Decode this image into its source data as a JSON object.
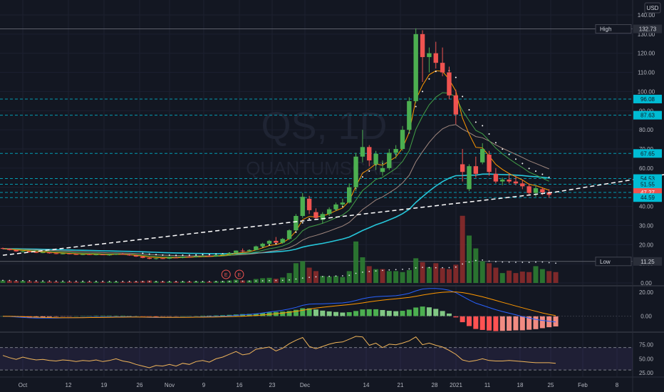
{
  "watermark": {
    "ticker": "QS, 1D",
    "name": "QUANTUMSCAPE"
  },
  "currency": "USD",
  "colors": {
    "up": "#26a69a",
    "down": "#ef5350",
    "ma_fast": "#ff9800",
    "ma_mid": "#43a047",
    "ma_slow": "#a1887f",
    "ma_long": "#26c6da",
    "levels": "#00bcd4",
    "trend": "#ffffff",
    "macd": "#2962ff",
    "signal": "#ff9800",
    "rsi": "#f0b55a",
    "rsi_band": "#7e57c2"
  },
  "main_axis": {
    "ticks": [
      "140.00",
      "130.00",
      "120.00",
      "110.00",
      "100.00",
      "90.00",
      "80.00",
      "70.00",
      "60.00",
      "50.00",
      "40.00",
      "30.00",
      "20.00",
      "10.00",
      "0.00"
    ]
  },
  "flags": {
    "high": {
      "label": "High",
      "value": "132.73"
    },
    "low": {
      "label": "Low",
      "value": "11.25"
    },
    "levels": [
      "96.08",
      "87.63",
      "67.65",
      "54.53",
      "51.55",
      "47.27",
      "44.59"
    ]
  },
  "earnings_markers": [
    "E",
    "E"
  ],
  "macd_axis": {
    "ticks": [
      "20.00",
      "0.00"
    ]
  },
  "rsi_axis": {
    "ticks": [
      "75.00",
      "50.00",
      "25.00"
    ]
  },
  "time_axis": {
    "labels": [
      "Oct",
      "12",
      "19",
      "26",
      "Nov",
      "9",
      "16",
      "23",
      "Dec",
      "14",
      "21",
      "28",
      "2021",
      "11",
      "18",
      "25",
      "Feb",
      "8"
    ]
  },
  "chart_data": {
    "type": "candlestick",
    "ylim": [
      0,
      140
    ],
    "candles": [
      [
        18.2,
        18.5,
        17.6,
        17.9
      ],
      [
        17.9,
        18.1,
        17,
        17.2
      ],
      [
        17.2,
        17.4,
        16.3,
        16.5
      ],
      [
        16.5,
        16.9,
        15.9,
        16.6
      ],
      [
        16.6,
        16.8,
        15.9,
        16.1
      ],
      [
        16.1,
        16.4,
        15.6,
        15.8
      ],
      [
        15.8,
        16.2,
        15.5,
        16
      ],
      [
        16,
        16.2,
        15.3,
        15.5
      ],
      [
        15.5,
        15.8,
        15,
        15.3
      ],
      [
        15.3,
        15.6,
        14.9,
        15.4
      ],
      [
        15.4,
        15.7,
        15,
        15.1
      ],
      [
        15.1,
        15.4,
        14.6,
        14.8
      ],
      [
        14.8,
        15.2,
        14.5,
        15
      ],
      [
        15,
        15.3,
        14.6,
        14.7
      ],
      [
        14.7,
        15.1,
        14.4,
        14.9
      ],
      [
        14.9,
        15.2,
        14.5,
        14.6
      ],
      [
        14.6,
        14.9,
        14.2,
        14.8
      ],
      [
        14.8,
        15.3,
        14.6,
        15.2
      ],
      [
        15.2,
        15.5,
        14.8,
        14.9
      ],
      [
        14.9,
        15.2,
        14.2,
        14.4
      ],
      [
        14.4,
        14.7,
        13.6,
        13.8
      ],
      [
        13.8,
        14.1,
        12.9,
        13.1
      ],
      [
        13.1,
        13.4,
        12.4,
        12.6
      ],
      [
        12.6,
        13.1,
        12.2,
        12.9
      ],
      [
        12.9,
        13.3,
        12.5,
        12.7
      ],
      [
        12.7,
        13.5,
        12.5,
        13.3
      ],
      [
        13.3,
        13.8,
        13,
        13.1
      ],
      [
        13.1,
        13.9,
        12.9,
        13.7
      ],
      [
        13.7,
        14.2,
        13.4,
        13.5
      ],
      [
        13.5,
        14.2,
        13.3,
        14
      ],
      [
        14,
        14.5,
        13.7,
        14.2
      ],
      [
        14.2,
        14.6,
        13.8,
        13.9
      ],
      [
        13.9,
        14.8,
        13.7,
        14.6
      ],
      [
        14.6,
        15.2,
        14.3,
        14.9
      ],
      [
        14.9,
        16,
        14.6,
        15.7
      ],
      [
        15.7,
        17,
        15.5,
        16.9
      ],
      [
        16.9,
        18,
        16.4,
        16.6
      ],
      [
        16.6,
        17.5,
        16.2,
        17.2
      ],
      [
        17.2,
        19.5,
        17,
        19.1
      ],
      [
        19.1,
        21,
        18.5,
        20.5
      ],
      [
        20.5,
        22.5,
        20,
        22
      ],
      [
        22,
        24,
        21.5,
        21
      ],
      [
        21,
        23.5,
        20.5,
        23
      ],
      [
        23,
        28,
        22.5,
        27.5
      ],
      [
        27.5,
        36,
        27,
        35
      ],
      [
        35,
        47,
        34,
        45
      ],
      [
        44,
        45.5,
        36,
        38
      ],
      [
        37,
        39,
        33,
        34
      ],
      [
        33,
        37,
        31,
        36
      ],
      [
        36,
        39.5,
        35,
        38.5
      ],
      [
        38.5,
        42,
        37.5,
        41
      ],
      [
        41,
        44,
        40,
        42
      ],
      [
        42,
        52,
        41.5,
        50
      ],
      [
        50,
        68,
        48,
        66
      ],
      [
        66,
        80,
        63,
        71
      ],
      [
        71,
        72,
        61,
        64
      ],
      [
        62,
        69,
        59,
        67.5
      ],
      [
        58,
        64,
        56,
        60
      ],
      [
        60,
        70,
        59,
        68
      ],
      [
        68,
        72,
        65,
        70
      ],
      [
        70,
        82,
        69,
        80
      ],
      [
        80,
        97,
        78,
        95
      ],
      [
        95,
        133,
        94,
        130
      ],
      [
        130,
        132,
        105,
        118
      ],
      [
        118,
        123,
        110,
        120
      ],
      [
        120,
        126,
        112,
        115
      ],
      [
        115,
        123,
        108,
        110
      ],
      [
        110,
        113,
        96,
        98
      ],
      [
        98,
        101,
        83,
        88
      ],
      [
        62,
        70,
        53,
        58
      ],
      [
        49,
        62,
        48,
        61
      ],
      [
        61,
        66,
        55,
        57
      ],
      [
        63,
        73,
        62,
        70
      ],
      [
        67,
        69,
        56,
        58
      ],
      [
        57,
        60,
        52,
        53
      ],
      [
        53,
        55,
        51,
        54
      ],
      [
        54,
        57,
        52,
        53
      ],
      [
        53,
        56,
        51,
        52
      ],
      [
        52,
        54,
        49,
        50.5
      ],
      [
        50.5,
        52,
        46,
        47
      ],
      [
        47,
        51,
        45,
        49.5
      ],
      [
        49,
        50,
        46,
        47.3
      ],
      [
        47.3,
        49,
        44.5,
        46
      ]
    ],
    "volume": [
      [
        2.6,
        1
      ],
      [
        2.4,
        0
      ],
      [
        2.1,
        0
      ],
      [
        2.2,
        1
      ],
      [
        1.8,
        0
      ],
      [
        1.6,
        0
      ],
      [
        1.5,
        1
      ],
      [
        1.6,
        0
      ],
      [
        1.4,
        0
      ],
      [
        1.4,
        1
      ],
      [
        1.4,
        0
      ],
      [
        1.3,
        0
      ],
      [
        1.4,
        1
      ],
      [
        1.3,
        0
      ],
      [
        1.3,
        1
      ],
      [
        1.2,
        0
      ],
      [
        1.3,
        1
      ],
      [
        1.4,
        1
      ],
      [
        1.2,
        0
      ],
      [
        1.3,
        0
      ],
      [
        1.6,
        0
      ],
      [
        2,
        0
      ],
      [
        2.5,
        0
      ],
      [
        1.7,
        1
      ],
      [
        1.6,
        0
      ],
      [
        1.5,
        1
      ],
      [
        1.5,
        0
      ],
      [
        1.6,
        1
      ],
      [
        1.5,
        0
      ],
      [
        1.7,
        1
      ],
      [
        1.5,
        1
      ],
      [
        1.4,
        0
      ],
      [
        1.8,
        1
      ],
      [
        1.9,
        1
      ],
      [
        2.5,
        1
      ],
      [
        3.3,
        1
      ],
      [
        2.5,
        0
      ],
      [
        2.5,
        1
      ],
      [
        4,
        1
      ],
      [
        4.8,
        1
      ],
      [
        5.2,
        1
      ],
      [
        4.3,
        0
      ],
      [
        5.5,
        1
      ],
      [
        10,
        1
      ],
      [
        20,
        1
      ],
      [
        22,
        1
      ],
      [
        15.5,
        0
      ],
      [
        12,
        0
      ],
      [
        7,
        1
      ],
      [
        6.5,
        1
      ],
      [
        7,
        1
      ],
      [
        6,
        1
      ],
      [
        12,
        1
      ],
      [
        42,
        1
      ],
      [
        26,
        1
      ],
      [
        17,
        0
      ],
      [
        14,
        1
      ],
      [
        14,
        0
      ],
      [
        12,
        1
      ],
      [
        12,
        1
      ],
      [
        11,
        1
      ],
      [
        13,
        1
      ],
      [
        25,
        1
      ],
      [
        21,
        0
      ],
      [
        16,
        1
      ],
      [
        20,
        0
      ],
      [
        15,
        0
      ],
      [
        14,
        0
      ],
      [
        18.5,
        0
      ],
      [
        68,
        0
      ],
      [
        48,
        1
      ],
      [
        35,
        1
      ],
      [
        22,
        1
      ],
      [
        20,
        0
      ],
      [
        15.5,
        0
      ],
      [
        10,
        1
      ],
      [
        12.5,
        0
      ],
      [
        10,
        0
      ],
      [
        11.5,
        0
      ],
      [
        11,
        0
      ],
      [
        17,
        1
      ],
      [
        14,
        1
      ],
      [
        12,
        0
      ],
      [
        11,
        0
      ]
    ],
    "volume_max": 70,
    "trendline": [
      [
        0,
        14.5
      ],
      [
        83,
        47.5
      ],
      [
        100,
        57
      ]
    ],
    "macd": {
      "ylim": [
        -12,
        24
      ],
      "macd": [
        0,
        -0.2,
        -0.6,
        -1,
        -1.3,
        -1.5,
        -1.5,
        -1.5,
        -1.5,
        -1.4,
        -1.3,
        -1.2,
        -1,
        -0.9,
        -0.8,
        -0.7,
        -0.6,
        -0.5,
        -0.5,
        -0.5,
        -0.6,
        -0.8,
        -1,
        -1.1,
        -1.1,
        -1.1,
        -1,
        -0.9,
        -0.8,
        -0.6,
        -0.5,
        -0.4,
        -0.2,
        0,
        0.3,
        0.7,
        1.1,
        1.5,
        2,
        2.7,
        3.5,
        4.2,
        5,
        6,
        7.3,
        9,
        10,
        10.2,
        10.3,
        10.5,
        10.8,
        11,
        11.7,
        13,
        14.5,
        15.5,
        16.2,
        16.5,
        16.7,
        17,
        17.8,
        19,
        21,
        22.5,
        23,
        23,
        22.5,
        21.5,
        19.5,
        16.5,
        13.5,
        10.8,
        9,
        7.2,
        5.4,
        3.9,
        2.5,
        1.2,
        -0.3,
        -1.5,
        -2.6,
        -3.5,
        -4.2,
        -4.8
      ],
      "signal": [
        0,
        -0.1,
        -0.2,
        -0.4,
        -0.6,
        -0.8,
        -1,
        -1.1,
        -1.2,
        -1.2,
        -1.2,
        -1.2,
        -1.2,
        -1.1,
        -1.1,
        -1,
        -0.9,
        -0.8,
        -0.8,
        -0.7,
        -0.7,
        -0.7,
        -0.8,
        -0.8,
        -0.9,
        -0.9,
        -0.9,
        -0.9,
        -0.9,
        -0.8,
        -0.8,
        -0.7,
        -0.6,
        -0.5,
        -0.4,
        -0.2,
        0,
        0.3,
        0.6,
        1,
        1.5,
        2,
        2.6,
        3.3,
        4,
        4.9,
        5.9,
        6.7,
        7.4,
        8,
        8.6,
        9.1,
        9.6,
        10.3,
        11,
        11.9,
        12.6,
        13.3,
        13.9,
        14.4,
        15,
        15.6,
        16.5,
        17.5,
        18.4,
        19.2,
        19.8,
        20.1,
        20.1,
        19.6,
        18.6,
        17.4,
        16.1,
        14.6,
        13.1,
        11.5,
        10,
        8.5,
        7,
        5.5,
        4.1,
        2.7,
        1.5,
        0.5
      ],
      "hist_max": 5
    },
    "rsi": {
      "ylim": [
        20,
        95
      ],
      "upper": 70,
      "lower": 30,
      "values": [
        56,
        52,
        49,
        53,
        50,
        48,
        49,
        47,
        46,
        48,
        47,
        45,
        47,
        46,
        48,
        45,
        47,
        50,
        46,
        44,
        40,
        37,
        34,
        38,
        37,
        40,
        37,
        42,
        40,
        45,
        47,
        44,
        50,
        53,
        58,
        63,
        57,
        59,
        67,
        69,
        71,
        64,
        69,
        77,
        83,
        88,
        72,
        68,
        72,
        76,
        79,
        80,
        85,
        90,
        89,
        74,
        78,
        70,
        76,
        75,
        78,
        82,
        89,
        75,
        78,
        74,
        71,
        65,
        58,
        48,
        45,
        47,
        50,
        47,
        46,
        46,
        47,
        46,
        45,
        44,
        43,
        43,
        43,
        42
      ]
    }
  }
}
